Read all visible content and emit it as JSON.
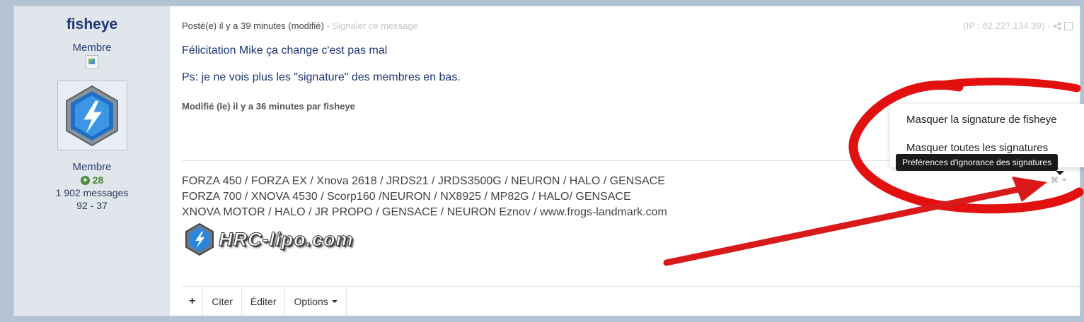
{
  "author": {
    "name": "fisheye",
    "rank_title": "Membre",
    "group": "Membre",
    "reputation": "28",
    "message_count": "1 902 messages",
    "score": "92 - 37"
  },
  "post": {
    "posted": "Posté(e) il y a 39 minutes (modifié)",
    "separator": " · ",
    "report_link": "Signaler ce message",
    "ip": "(IP : 82.227.134.39) ·",
    "body": [
      "Félicitation Mike ça change c'est pas mal",
      "Ps: je ne vois plus les \"signature\"  des membres en bas."
    ],
    "edited_note": "Modifié (le) il y a 36 minutes par fisheye"
  },
  "signature": {
    "lines": [
      "FORZA 450 / FORZA EX  / Xnova 2618 / JRDS21 / JRDS3500G / NEURON / HALO / GENSACE",
      "FORZA 700 / XNOVA 4530 / Scorp160 /NEURON / NX8925 / MP82G / HALO/ GENSACE",
      "XNOVA MOTOR / HALO / JR PROPO / GENSACE / NEURON Eznov  / www.frogs-landmark.com"
    ],
    "logo_text": "HRC-lipo.com"
  },
  "ignore_menu": {
    "items": [
      "Masquer la signature de fisheye",
      "Masquer toutes les signatures"
    ],
    "tooltip": "Préférences d'ignorance des signatures"
  },
  "footer": {
    "plus": "+",
    "quote": "Citer",
    "edit": "Éditer",
    "options": "Options"
  },
  "colors": {
    "page_bg": "#b4c3d3",
    "author_panel_bg": "#e0e6ec",
    "author_name": "#1f3474",
    "reputation_green": "#4a8a3a",
    "annotation_red": "#e31010"
  }
}
